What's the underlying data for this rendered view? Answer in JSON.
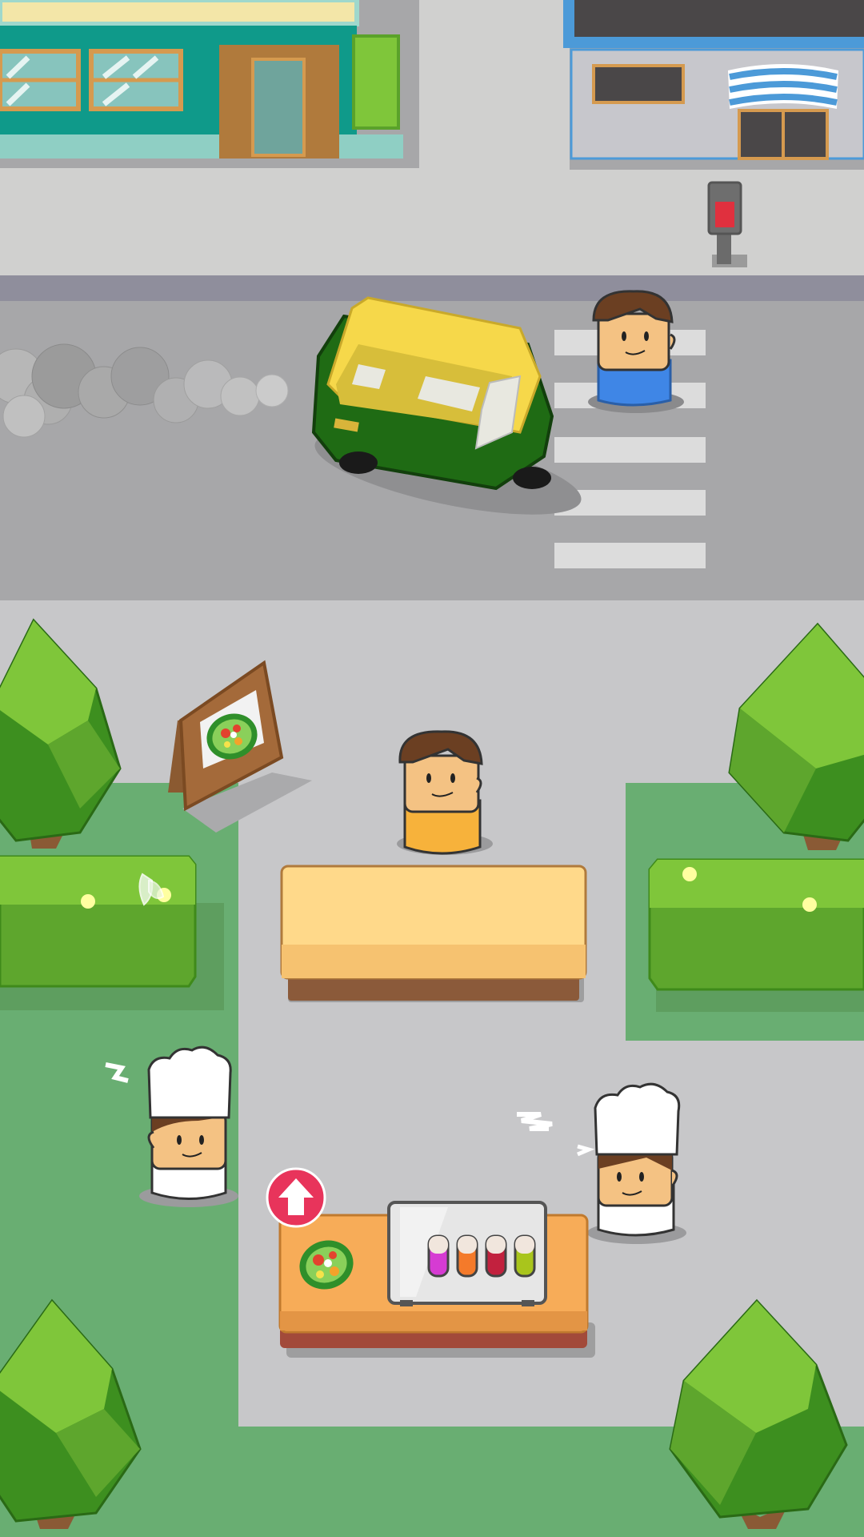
{
  "game": {
    "genre": "restaurant-management",
    "palette": {
      "grass": "#69ae72",
      "road": "#a7a7a9",
      "plaza": "#c7c7c9",
      "tree_light": "#7fc63a",
      "tree_dark": "#3d8f1f",
      "counter_top": "#ffd98a",
      "prep_table": "#f7ac58",
      "upgrade_badge": "#e8345b",
      "rickshaw_yellow": "#f6d84a",
      "rickshaw_green": "#1e6b14"
    },
    "street": {
      "shops": [
        "teal-storefront",
        "grey-storefront-with-striped-awning"
      ],
      "traffic_signal_state": "red",
      "vehicle": "auto-rickshaw",
      "pedestrian_shirt": "#3f86e6"
    },
    "shop": {
      "menu_board_item": "salad-icon",
      "customer_shirt": "#f7b23b",
      "chefs": 2,
      "prep_table": {
        "dish": "salad-icon",
        "dressing_bottles": [
          "#d63bd3",
          "#f47a2a",
          "#c2213e",
          "#a9c51c"
        ]
      },
      "upgrade_button": "arrow-up-icon"
    },
    "decor": {
      "hedge_flowers": "#ffffa0",
      "butterfly": "butterfly-icon"
    }
  }
}
